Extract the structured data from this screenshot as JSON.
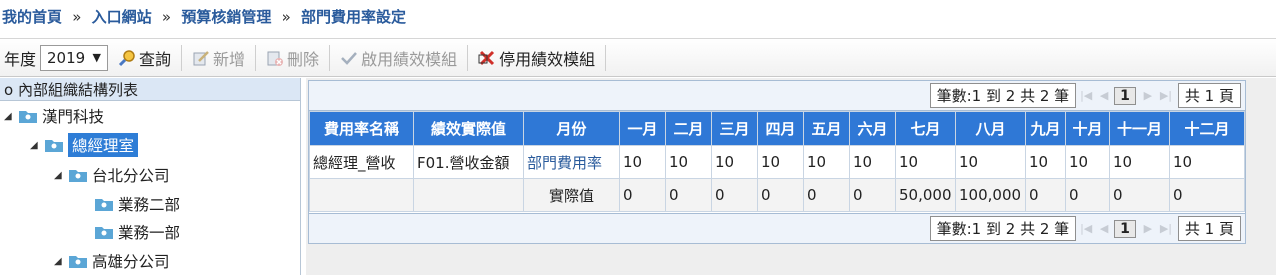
{
  "breadcrumb": {
    "home": "我的首頁",
    "portal": "入口網站",
    "module": "預算核銷管理",
    "current": "部門費用率設定",
    "sep": "»"
  },
  "toolbar": {
    "year_label": "年度",
    "year_value": "2019",
    "query": "查詢",
    "add": "新增",
    "delete": "刪除",
    "enable": "啟用績效模組",
    "disable": "停用績效模組"
  },
  "tree": {
    "header": "內部組織結構列表",
    "nodes": [
      {
        "label": "漢門科技"
      },
      {
        "label": "總經理室"
      },
      {
        "label": "台北分公司"
      },
      {
        "label": "業務二部"
      },
      {
        "label": "業務一部"
      },
      {
        "label": "高雄分公司"
      }
    ]
  },
  "pager": {
    "summary": "筆數:1 到 2 共 2 筆",
    "page": "1",
    "total": "共 1 頁"
  },
  "grid": {
    "columns": [
      "費用率名稱",
      "績效實際值",
      "月份",
      "一月",
      "二月",
      "三月",
      "四月",
      "五月",
      "六月",
      "七月",
      "八月",
      "九月",
      "十月",
      "十一月",
      "十二月"
    ],
    "row1": {
      "name": "總經理_營收",
      "metric": "F01.營收金額",
      "type": "部門費用率",
      "m": [
        "10",
        "10",
        "10",
        "10",
        "10",
        "10",
        "10",
        "10",
        "10",
        "10",
        "10",
        "10"
      ]
    },
    "row2": {
      "name": "",
      "metric": "",
      "type": "實際值",
      "m": [
        "0",
        "0",
        "0",
        "0",
        "0",
        "0",
        "50,000",
        "100,000",
        "0",
        "0",
        "0",
        "0"
      ]
    }
  },
  "colors": {
    "header_blue": "#2f78d6",
    "selected": "#2e7dd6",
    "link": "#2a5b9c"
  }
}
